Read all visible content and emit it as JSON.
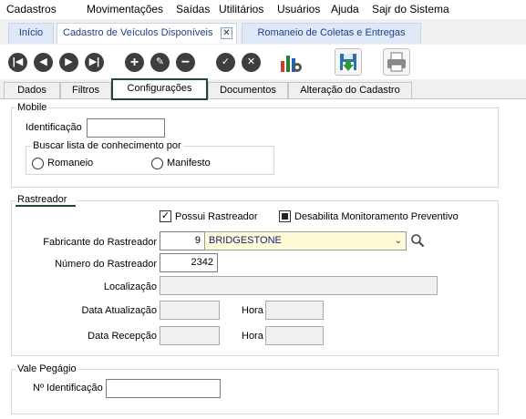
{
  "menu": {
    "items": [
      "Cadastros",
      "Movimentações",
      "Saídas",
      "Utilitários",
      "Usuários",
      "Ajuda",
      "Sajr do Sistema"
    ]
  },
  "tabs": {
    "home": "Início",
    "vehicles": "Cadastro de Veículos Disponíveis",
    "close_symbol": "✕",
    "romaneio": "Romaneio de Coletas e Entregas"
  },
  "toolbar": {
    "icons": [
      "first-icon",
      "prev-icon",
      "next-icon",
      "last-icon",
      "add-icon",
      "edit-icon",
      "remove-icon",
      "confirm-icon",
      "cancel-icon",
      "chart-settings-icon",
      "save-export-icon",
      "print-icon"
    ]
  },
  "form_tabs": [
    "Dados",
    "Filtros",
    "Configurações",
    "Documentos",
    "Alteração do Cadastro"
  ],
  "mobile": {
    "title": "Mobile",
    "identificacao_label": "Identificação",
    "identificacao_value": "",
    "buscar_title": "Buscar lista de conhecimento por",
    "romaneio": "Romaneio",
    "manifesto": "Manifesto"
  },
  "rastreador": {
    "title": "Rastreador",
    "possui_label": "Possui Rastreador",
    "possui_checked": true,
    "desabilita_label": "Desabilita Monitoramento Preventivo",
    "fabricante_label": "Fabricante do Rastreador",
    "fabricante_code": "9",
    "fabricante_name": "BRIDGESTONE",
    "numero_label": "Número do Rastreador",
    "numero_value": "2342",
    "localizacao_label": "Localização",
    "data_atualizacao_label": "Data Atualização",
    "data_recepcao_label": "Data Recepção",
    "hora_label": "Hora"
  },
  "vale_pedagio": {
    "title": "Vale Pegágio",
    "identificacao_label": "Nº Identificação",
    "identificacao_value": ""
  },
  "colors": {
    "accent": "#1d4a2a",
    "tab_text": "#1f3f8a",
    "combo_bg": "#fffbd7"
  }
}
